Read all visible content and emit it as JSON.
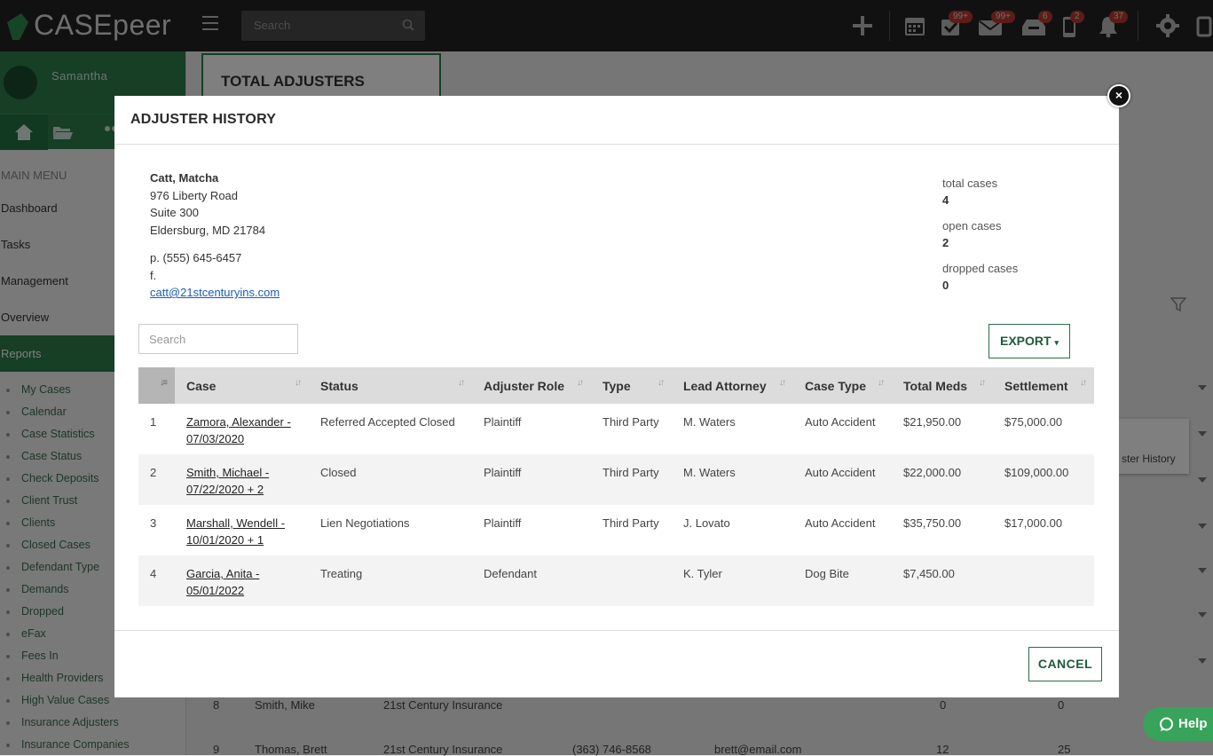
{
  "app": {
    "logo_text": "CASEpeer"
  },
  "topbar": {
    "search_placeholder": "Search",
    "badges": {
      "tasks": "99+",
      "messages": "99+",
      "inbox": "6",
      "phone": "2",
      "notifications": "37"
    }
  },
  "sidebar": {
    "user_name": "Samantha",
    "menu_heading": "MAIN MENU",
    "items": [
      "Dashboard",
      "Tasks",
      "Management",
      "Overview",
      "Reports"
    ],
    "active_item": "Reports",
    "sub_items": [
      "My Cases",
      "Calendar",
      "Case Statistics",
      "Case Status",
      "Check Deposits",
      "Client Trust",
      "Clients",
      "Closed Cases",
      "Defendant Type",
      "Demands",
      "Dropped",
      "eFax",
      "Fees In",
      "Health Providers",
      "High Value Cases",
      "Insurance Adjusters",
      "Insurance Companies"
    ]
  },
  "background": {
    "card_title": "TOTAL ADJUSTERS",
    "popup_text": "ster History",
    "rows": [
      {
        "num": "8",
        "name": "Smith, Mike",
        "company": "21st Century Insurance",
        "phone": "",
        "email": "",
        "a": "0",
        "b": "0"
      },
      {
        "num": "9",
        "name": "Thomas, Brett",
        "company": "21st Century Insurance",
        "phone": "(363) 746-8568",
        "email": "brett@email.com",
        "a": "12",
        "b": "25"
      }
    ]
  },
  "modal": {
    "title": "ADJUSTER HISTORY",
    "adjuster": {
      "name": "Catt, Matcha",
      "address1": "976 Liberty Road",
      "address2": "Suite 300",
      "city_state_zip": "Eldersburg, MD 21784",
      "phone": "p. (555) 645-6457",
      "fax": "f.",
      "email": "catt@21stcenturyins.com"
    },
    "stats": {
      "total_label": "total cases",
      "total_value": "4",
      "open_label": "open cases",
      "open_value": "2",
      "dropped_label": "dropped cases",
      "dropped_value": "0"
    },
    "search_placeholder": "Search",
    "export_label": "EXPORT",
    "columns": [
      "",
      "Case",
      "Status",
      "Adjuster Role",
      "Type",
      "Lead Attorney",
      "Case Type",
      "Total Meds",
      "Settlement"
    ],
    "rows": [
      {
        "n": "1",
        "case_line1": "Zamora, Alexander -",
        "case_line2": "07/03/2020",
        "status": "Referred Accepted Closed",
        "role": "Plaintiff",
        "type": "Third Party",
        "attorney": "M. Waters",
        "case_type": "Auto Accident",
        "meds": "$21,950.00",
        "settlement": "$75,000.00"
      },
      {
        "n": "2",
        "case_line1": "Smith, Michael -",
        "case_line2": "07/22/2020 + 2",
        "status": "Closed",
        "role": "Plaintiff",
        "type": "Third Party",
        "attorney": "M. Waters",
        "case_type": "Auto Accident",
        "meds": "$22,000.00",
        "settlement": "$109,000.00"
      },
      {
        "n": "3",
        "case_line1": "Marshall, Wendell -",
        "case_line2": "10/01/2020 + 1",
        "status": "Lien Negotiations",
        "role": "Plaintiff",
        "type": "Third Party",
        "attorney": "J. Lovato",
        "case_type": "Auto Accident",
        "meds": "$35,750.00",
        "settlement": "$17,000.00"
      },
      {
        "n": "4",
        "case_line1": "Garcia, Anita -",
        "case_line2": "05/01/2022",
        "status": "Treating",
        "role": "Defendant",
        "type": "",
        "attorney": "K. Tyler",
        "case_type": "Dog Bite",
        "meds": "$7,450.00",
        "settlement": ""
      }
    ],
    "cancel_label": "CANCEL"
  },
  "help": {
    "label": "Help"
  },
  "colors": {
    "brand_green": "#2d7f4a",
    "topbar": "#232323",
    "badge_red": "#b93a32"
  }
}
